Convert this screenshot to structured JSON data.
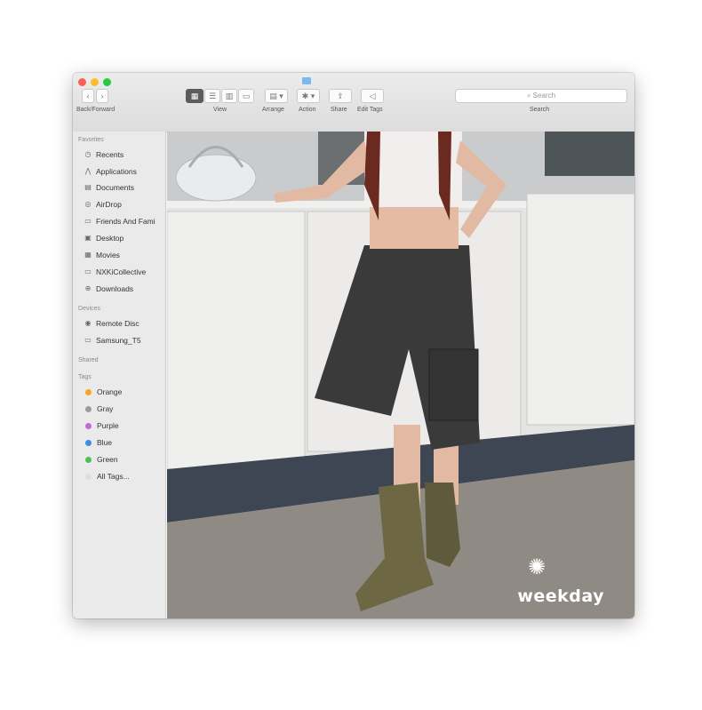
{
  "window": {
    "back_label": "Back/Forward",
    "view_label": "View",
    "arrange_label": "Arrange",
    "action_label": "Action",
    "share_label": "Share",
    "edit_tags_label": "Edit Tags",
    "search_placeholder": "Search",
    "search_label": "Search"
  },
  "sidebar": {
    "favorites_header": "Favorites",
    "favorites": [
      {
        "label": "Recents",
        "icon": "clock-icon"
      },
      {
        "label": "Applications",
        "icon": "applications-icon"
      },
      {
        "label": "Documents",
        "icon": "documents-icon"
      },
      {
        "label": "AirDrop",
        "icon": "airdrop-icon"
      },
      {
        "label": "Friends And Fami",
        "icon": "folder-icon"
      },
      {
        "label": "Desktop",
        "icon": "desktop-icon"
      },
      {
        "label": "Movies",
        "icon": "movies-icon"
      },
      {
        "label": "NXKiCollective",
        "icon": "folder-icon"
      },
      {
        "label": "Downloads",
        "icon": "downloads-icon"
      }
    ],
    "devices_header": "Devices",
    "devices": [
      {
        "label": "Remote Disc",
        "icon": "disc-icon"
      },
      {
        "label": "Samsung_T5",
        "icon": "drive-icon"
      }
    ],
    "shared_header": "Shared",
    "tags_header": "Tags",
    "tags": [
      {
        "label": "Orange",
        "color": "#f5a623"
      },
      {
        "label": "Gray",
        "color": "#9b9b9b"
      },
      {
        "label": "Purple",
        "color": "#c06bd8"
      },
      {
        "label": "Blue",
        "color": "#3d8fe0"
      },
      {
        "label": "Green",
        "color": "#4cc152"
      },
      {
        "label": "All Tags...",
        "color": "#dddddd"
      }
    ]
  },
  "content": {
    "watermark": "weekday"
  }
}
